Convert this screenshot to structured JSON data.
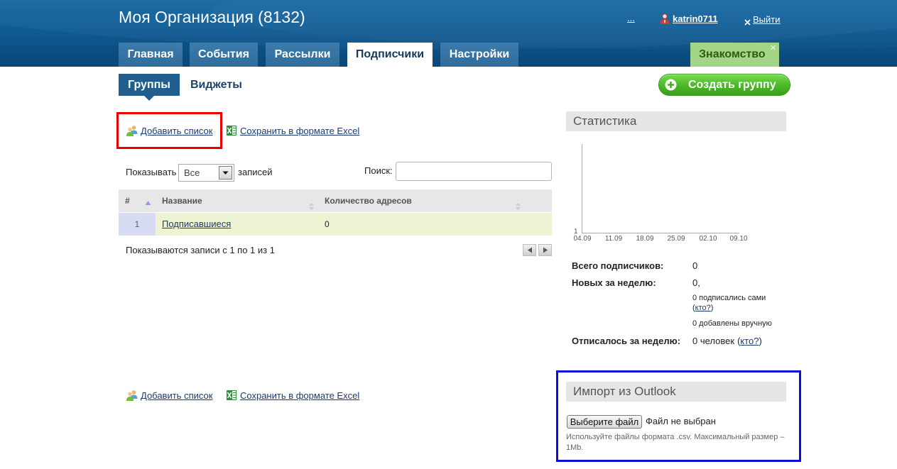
{
  "header": {
    "title": "Моя Организация (8132)",
    "more_link": "...",
    "user_icon": "user-icon",
    "username": "katrin0711",
    "logout_icon": "close-icon",
    "logout_label": "Выйти"
  },
  "main_tabs": [
    {
      "label": "Главная",
      "active": false
    },
    {
      "label": "События",
      "active": false
    },
    {
      "label": "Рассылки",
      "active": false
    },
    {
      "label": "Подписчики",
      "active": true
    },
    {
      "label": "Настройки",
      "active": false
    }
  ],
  "intro_tab": {
    "label": "Знакомство",
    "close": "×"
  },
  "sub_tabs": [
    {
      "label": "Группы",
      "active": true
    },
    {
      "label": "Виджеты",
      "active": false
    }
  ],
  "create_group_button": {
    "label": "Создать группу",
    "icon": "plus-circle-icon"
  },
  "actions_top": {
    "add_list_icon": "users-add-icon",
    "add_list": "Добавить список",
    "save_excel_icon": "excel-icon",
    "save_excel": "Сохранить в формате Excel"
  },
  "table_controls": {
    "show_label": "Показывать",
    "show_value": "Все",
    "records_label": "записей",
    "search_label": "Поиск:",
    "search_value": ""
  },
  "table": {
    "columns": [
      {
        "label": "#",
        "sort": "asc"
      },
      {
        "label": "Название",
        "sort": "none"
      },
      {
        "label": "Количество адресов",
        "sort": "none"
      }
    ],
    "rows": [
      {
        "num": "1",
        "name": "Подписавшиеся",
        "count": "0"
      }
    ],
    "info": "Показываются записи с 1 по 1 из 1"
  },
  "actions_bottom": {
    "add_list_icon": "users-add-icon",
    "add_list": "Добавить список",
    "save_excel_icon": "excel-icon",
    "save_excel": "Сохранить в формате Excel"
  },
  "stats": {
    "title": "Статистика",
    "chart": {
      "y_ticks": [
        "1"
      ],
      "x_ticks": [
        "04.09",
        "11.09",
        "18.09",
        "25.09",
        "02.10",
        "09.10"
      ]
    },
    "total_label": "Всего подписчиков:",
    "total_value": "0",
    "new_label": "Новых за неделю:",
    "new_value": "0,",
    "self_subscribed": "0 подписались сами",
    "self_who": {
      "open": "(",
      "link": "кто?",
      "close": ")"
    },
    "manual_added": "0 добавлены вручную",
    "unsub_label": "Отписалось за неделю:",
    "unsub_value": "0 человек",
    "unsub_who": {
      "open": "(",
      "link": "кто?",
      "close": ")"
    }
  },
  "import": {
    "title": "Импорт из Outlook",
    "choose_button": "Выберите файл",
    "no_file": "Файл не выбран",
    "hint": "Используйте файлы формата .csv. Максимальный размер – 1Mb."
  },
  "colors": {
    "header_bg": "#0f5d96",
    "tab_bg": "#3574a5",
    "active_subtab_bg": "#1f5e8d",
    "intro_tab_bg": "#a4d587",
    "create_button_bg": "#47b526",
    "link": "#1b3b6f",
    "row_bg": "#eef3d4",
    "annotation_red": "#e30000",
    "annotation_blue": "#0c0cde"
  }
}
